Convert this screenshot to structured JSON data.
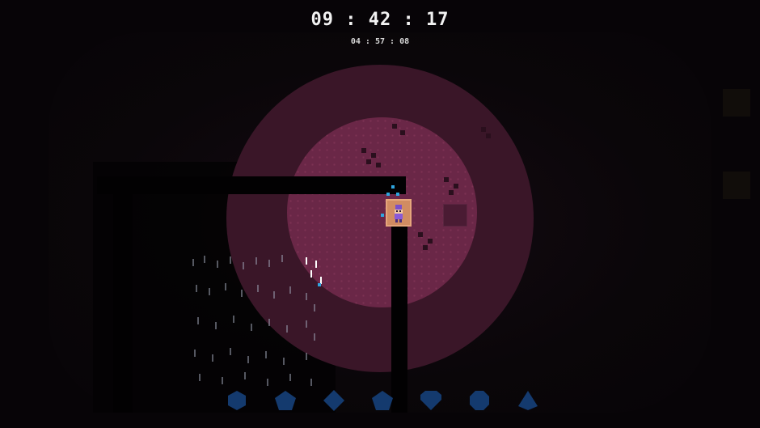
{
  "hud": {
    "main_timer": "09 : 42 : 17",
    "sub_timer": "04 : 57 : 08"
  },
  "gem_slots": [
    {
      "icon": "hexagon-gem-icon",
      "collected": false
    },
    {
      "icon": "pentagon-gem-icon",
      "collected": false
    },
    {
      "icon": "diamond-gem-icon",
      "collected": false
    },
    {
      "icon": "pentagon-gem-icon",
      "collected": false
    },
    {
      "icon": "heart-gem-icon",
      "collected": false
    },
    {
      "icon": "octagon-gem-icon",
      "collected": false
    },
    {
      "icon": "triangle-gem-icon",
      "collected": false
    }
  ],
  "colors": {
    "gem_slot": "#143a6e",
    "light_inner": "#6a2747",
    "light_outer": "#3a1628",
    "player_tile": "#d18c62",
    "sparkle": "#2fa6e0"
  }
}
